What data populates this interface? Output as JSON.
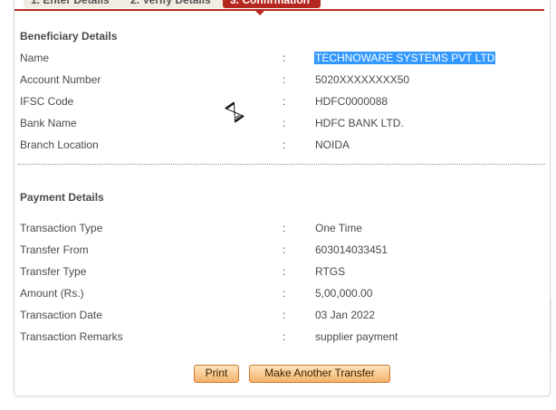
{
  "steps": [
    {
      "label": "1. Enter Details"
    },
    {
      "label": "2. Verify Details"
    },
    {
      "label": "3. Confirmation"
    }
  ],
  "beneficiary": {
    "title": "Beneficiary Details",
    "rows": [
      {
        "label": "Name",
        "sep": ":",
        "value": "TECHNOWARE SYSTEMS PVT LTD"
      },
      {
        "label": "Account Number",
        "sep": ":",
        "value": "5020XXXXXXXX50"
      },
      {
        "label": "IFSC Code",
        "sep": ":",
        "value": "HDFC0000088"
      },
      {
        "label": "Bank Name",
        "sep": ":",
        "value": "HDFC BANK LTD."
      },
      {
        "label": "Branch Location",
        "sep": ":",
        "value": "NOIDA"
      }
    ]
  },
  "payment": {
    "title": "Payment Details",
    "rows": [
      {
        "label": "Transaction Type",
        "sep": ":",
        "value": "One Time"
      },
      {
        "label": "Transfer From",
        "sep": ":",
        "value": "603014033451"
      },
      {
        "label": "Transfer Type",
        "sep": ":",
        "value": "RTGS"
      },
      {
        "label": "Amount (Rs.)",
        "sep": ":",
        "value": "5,00,000.00"
      },
      {
        "label": "Transaction Date",
        "sep": ":",
        "value": "03 Jan 2022"
      },
      {
        "label": "Transaction Remarks",
        "sep": ":",
        "value": "supplier payment"
      }
    ]
  },
  "buttons": {
    "print": "Print",
    "another": "Make Another Transfer"
  },
  "colors": {
    "accent": "#b5281f",
    "selection": "#3399ff",
    "button_top": "#fde3bd",
    "button_bottom": "#f5b26b"
  },
  "icons": {
    "cursor": "hourglass-busy-cursor-icon"
  }
}
